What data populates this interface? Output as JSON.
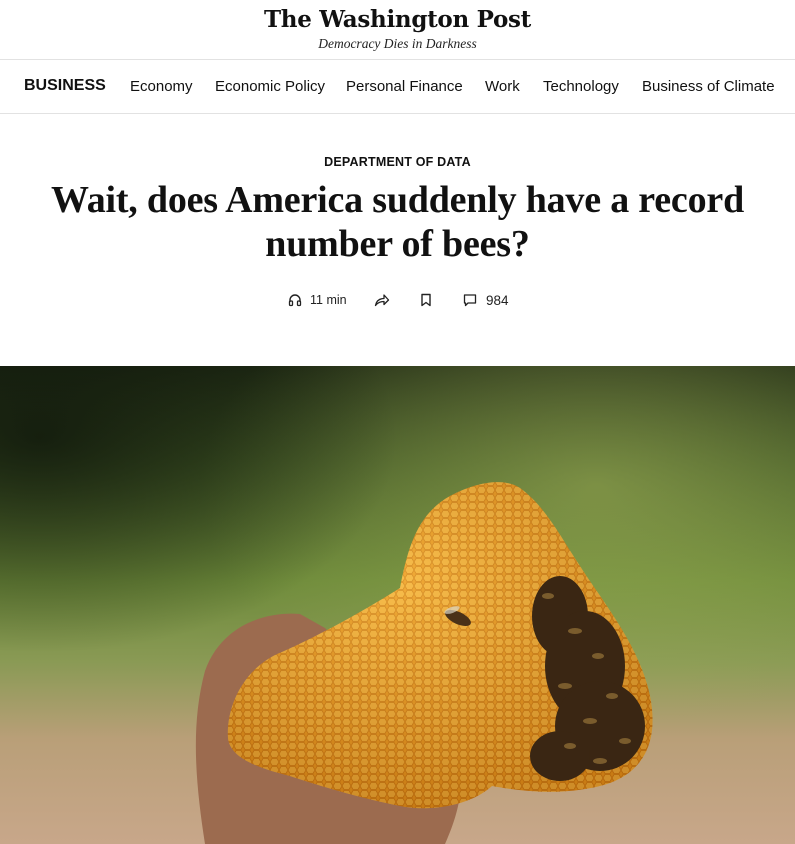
{
  "masthead": {
    "brand": "The Washington Post",
    "tagline": "Democracy Dies in Darkness"
  },
  "nav": {
    "section": "BUSINESS",
    "links": [
      "Economy",
      "Economic Policy",
      "Personal Finance",
      "Work",
      "Technology",
      "Business of Climate"
    ]
  },
  "article": {
    "kicker": "DEPARTMENT OF DATA",
    "headline": "Wait, does America suddenly have a record number of bees?",
    "tools": {
      "listen_label": "11 min",
      "comment_count": "984",
      "icons": [
        "headphones-icon",
        "share-icon",
        "bookmark-icon",
        "comment-icon"
      ]
    }
  },
  "colors": {
    "text": "#111111",
    "divider": "#e2e2e2",
    "honey": "#e9951c",
    "foliage": "#4f7a2e"
  }
}
